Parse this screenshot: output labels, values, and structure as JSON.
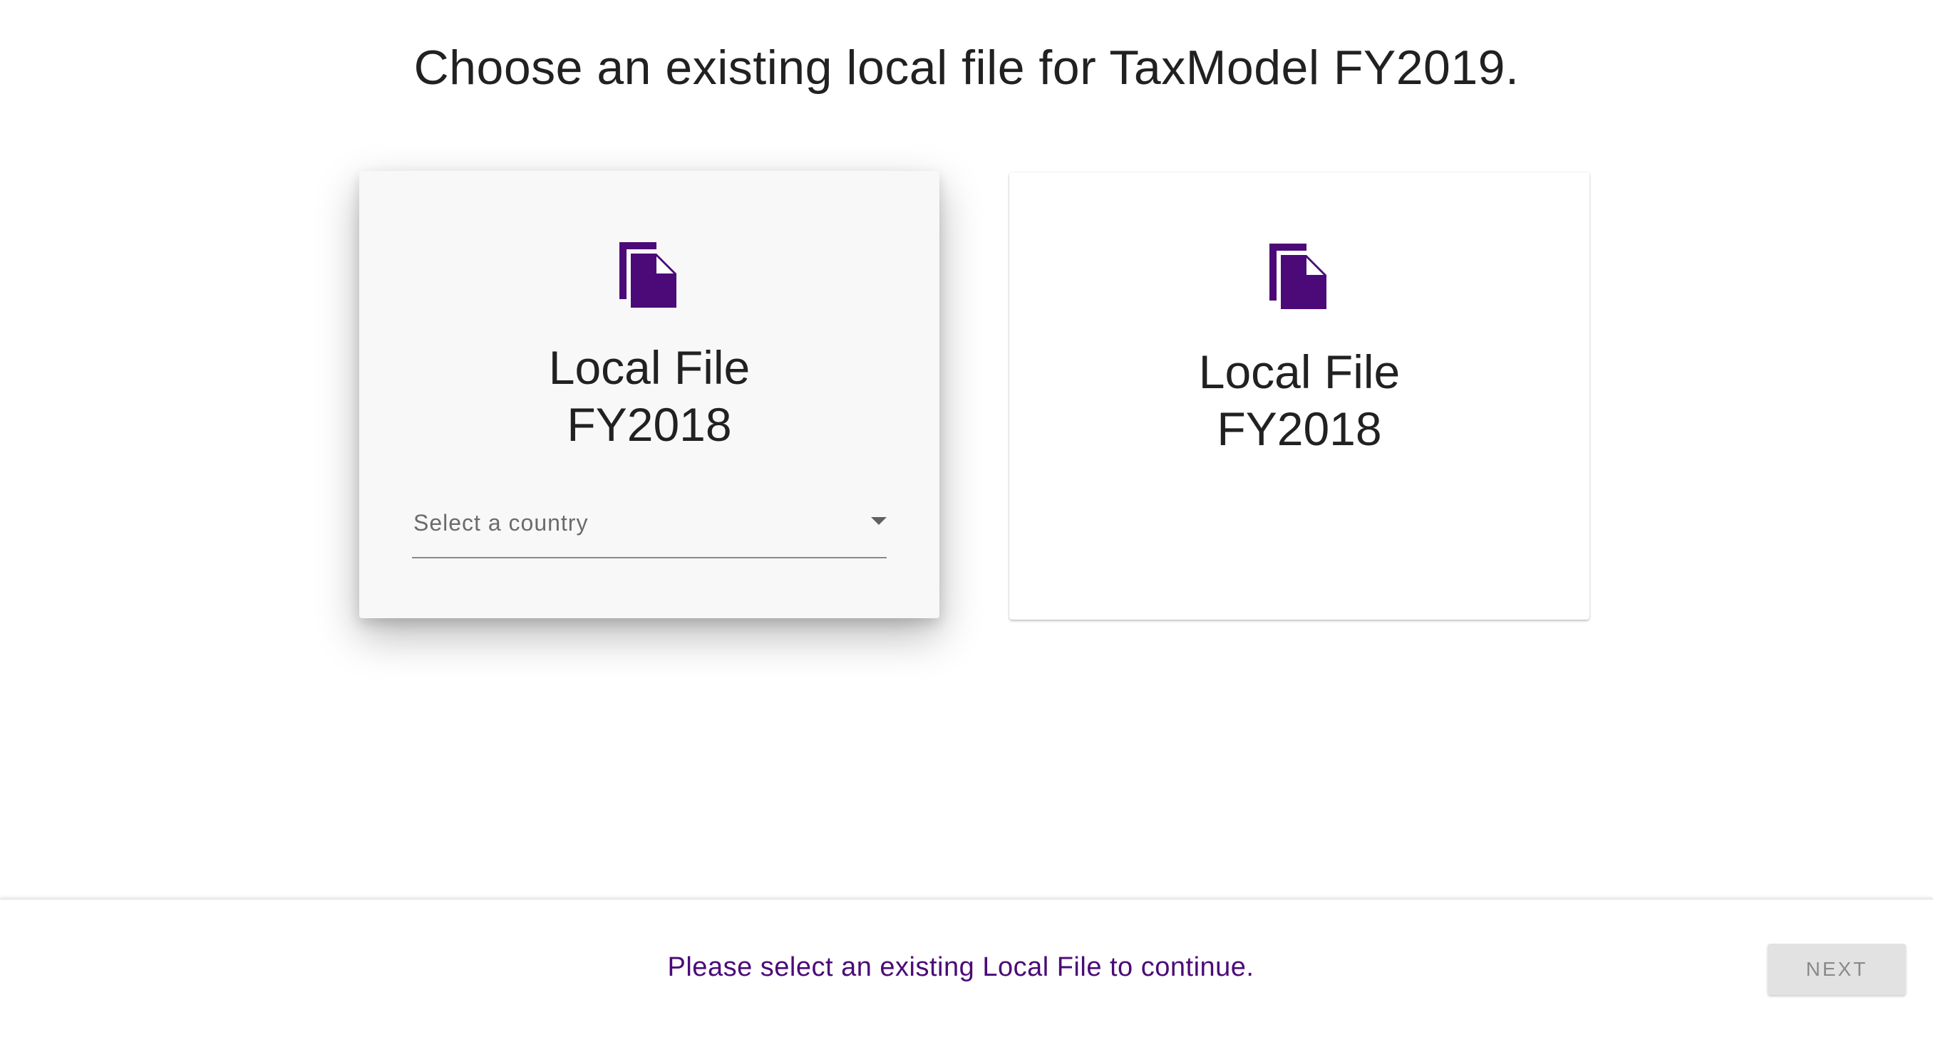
{
  "page": {
    "title": "Choose an existing local file for TaxModel FY2019."
  },
  "cards": [
    {
      "title_line1": "Local File",
      "title_line2": "FY2018",
      "icon": "file-copy-icon",
      "country_select": {
        "placeholder": "Select a country"
      }
    },
    {
      "title_line1": "Local File",
      "title_line2": "FY2018",
      "icon": "file-copy-icon"
    }
  ],
  "footer": {
    "message": "Please select an existing Local File to continue.",
    "next_label": "NEXT"
  },
  "colors": {
    "accent": "#4b0a78",
    "disabled_button_bg": "#e2e2e2",
    "disabled_button_text": "#8a8a8a"
  }
}
